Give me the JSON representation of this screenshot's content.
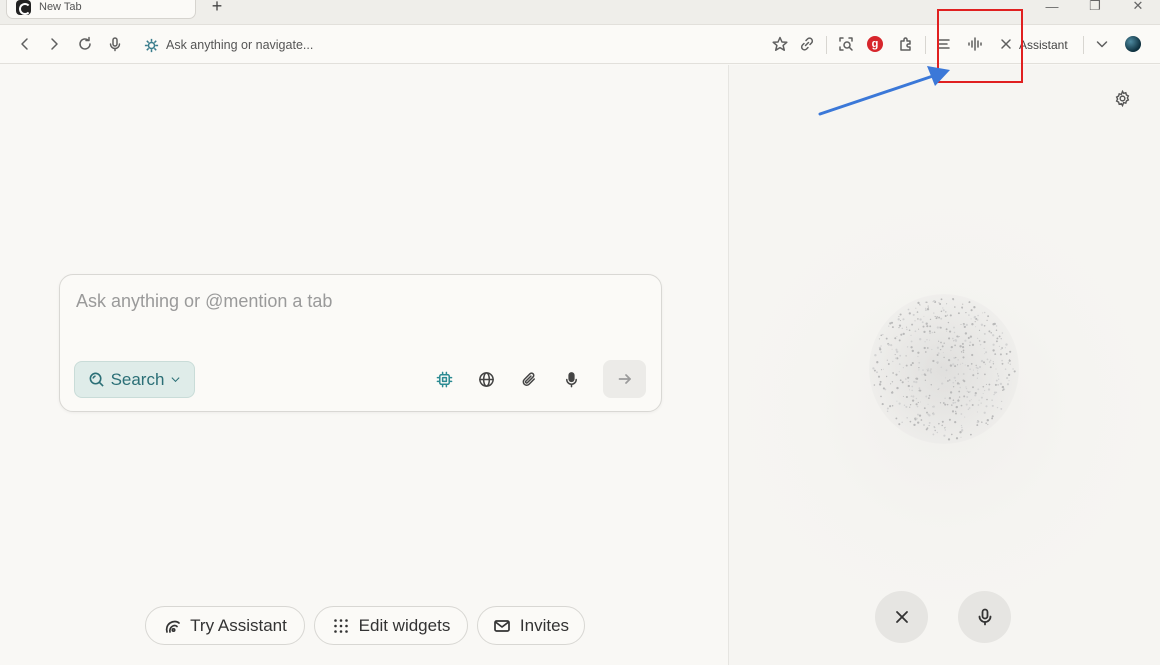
{
  "tab": {
    "title": "New Tab",
    "new_tab_symbol": "+"
  },
  "window_controls": {
    "minimize": "—",
    "restore": "❐",
    "close": "✕"
  },
  "toolbar": {
    "address_placeholder": "Ask anything or navigate...",
    "grammarly_badge": "g",
    "assistant_label": "Assistant"
  },
  "prompt": {
    "placeholder": "Ask anything or @mention a tab",
    "search_label": "Search"
  },
  "bottom_pills": {
    "try_assistant": "Try Assistant",
    "edit_widgets": "Edit widgets",
    "invites": "Invites"
  },
  "colors": {
    "annotation_red": "#e02020",
    "annotation_arrow": "#3b78d8",
    "accent_teal": "#2b6f76"
  }
}
